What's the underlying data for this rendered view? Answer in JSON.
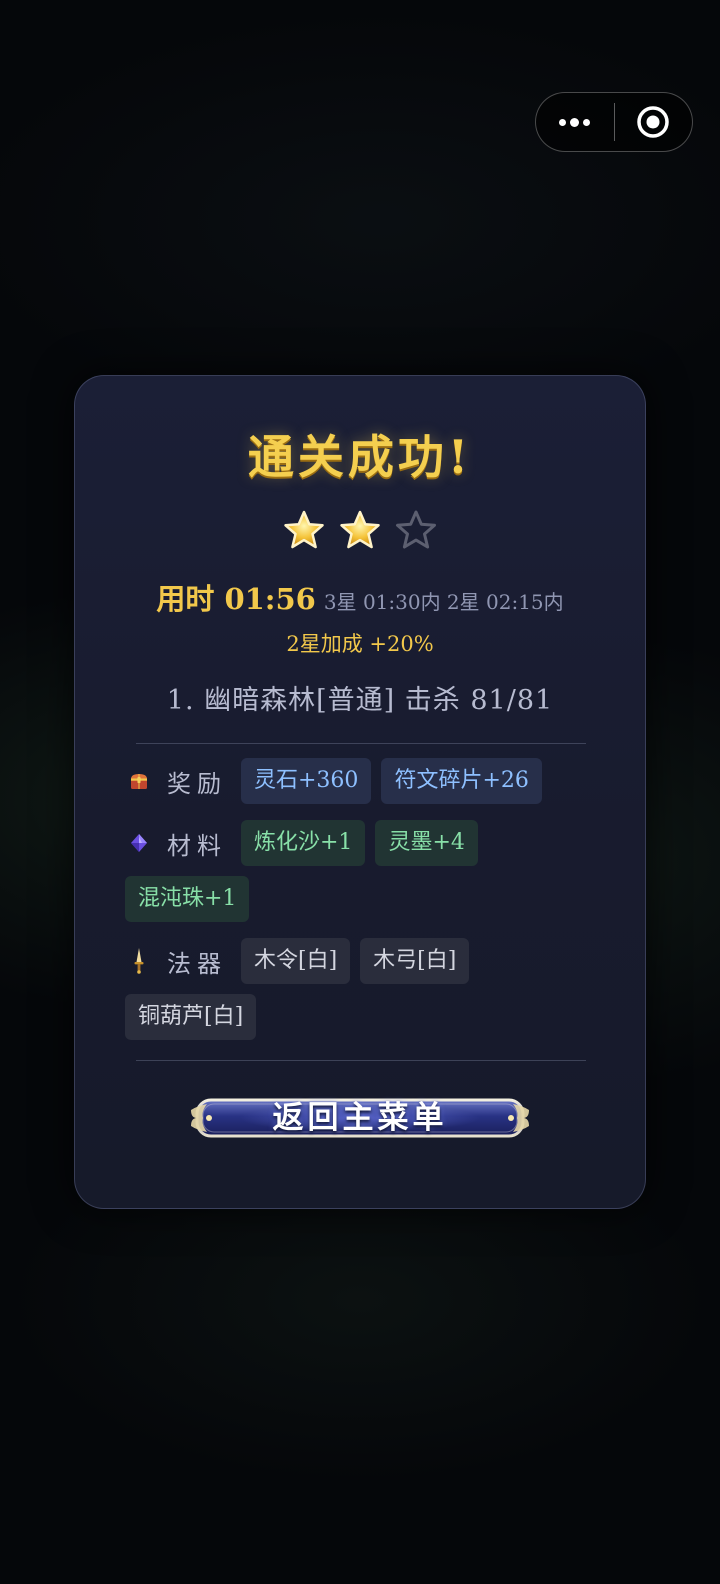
{
  "capsule": {
    "more_icon": "more-dots-icon",
    "close_icon": "target-circle-icon"
  },
  "result": {
    "title": "通关成功!",
    "stars": {
      "earned": 2,
      "total": 3
    },
    "time_label": "用时 01:56",
    "star_requirements": "3星 01:30内  2星 02:15内",
    "bonus": "2星加成 +20%",
    "stage": "1. 幽暗森林[普通] 击杀 81/81"
  },
  "rewards": {
    "label": "奖励",
    "icon": "treasure-chest-icon",
    "items": [
      "灵石+360",
      "符文碎片+26"
    ]
  },
  "materials": {
    "label": "材料",
    "icon": "purple-gem-icon",
    "items": [
      "炼化沙+1",
      "灵墨+4",
      "混沌珠+1"
    ]
  },
  "artifacts": {
    "label": "法器",
    "icon": "dagger-icon",
    "items": [
      "木令[白]",
      "木弓[白]",
      "铜葫芦[白]"
    ]
  },
  "actions": {
    "back_to_menu": "返回主菜单"
  },
  "colors": {
    "gold": "#f2c84b",
    "reward_blue": "#8ec0ff",
    "material_green": "#88e0a8",
    "artifact_white": "#d4d6e0"
  }
}
